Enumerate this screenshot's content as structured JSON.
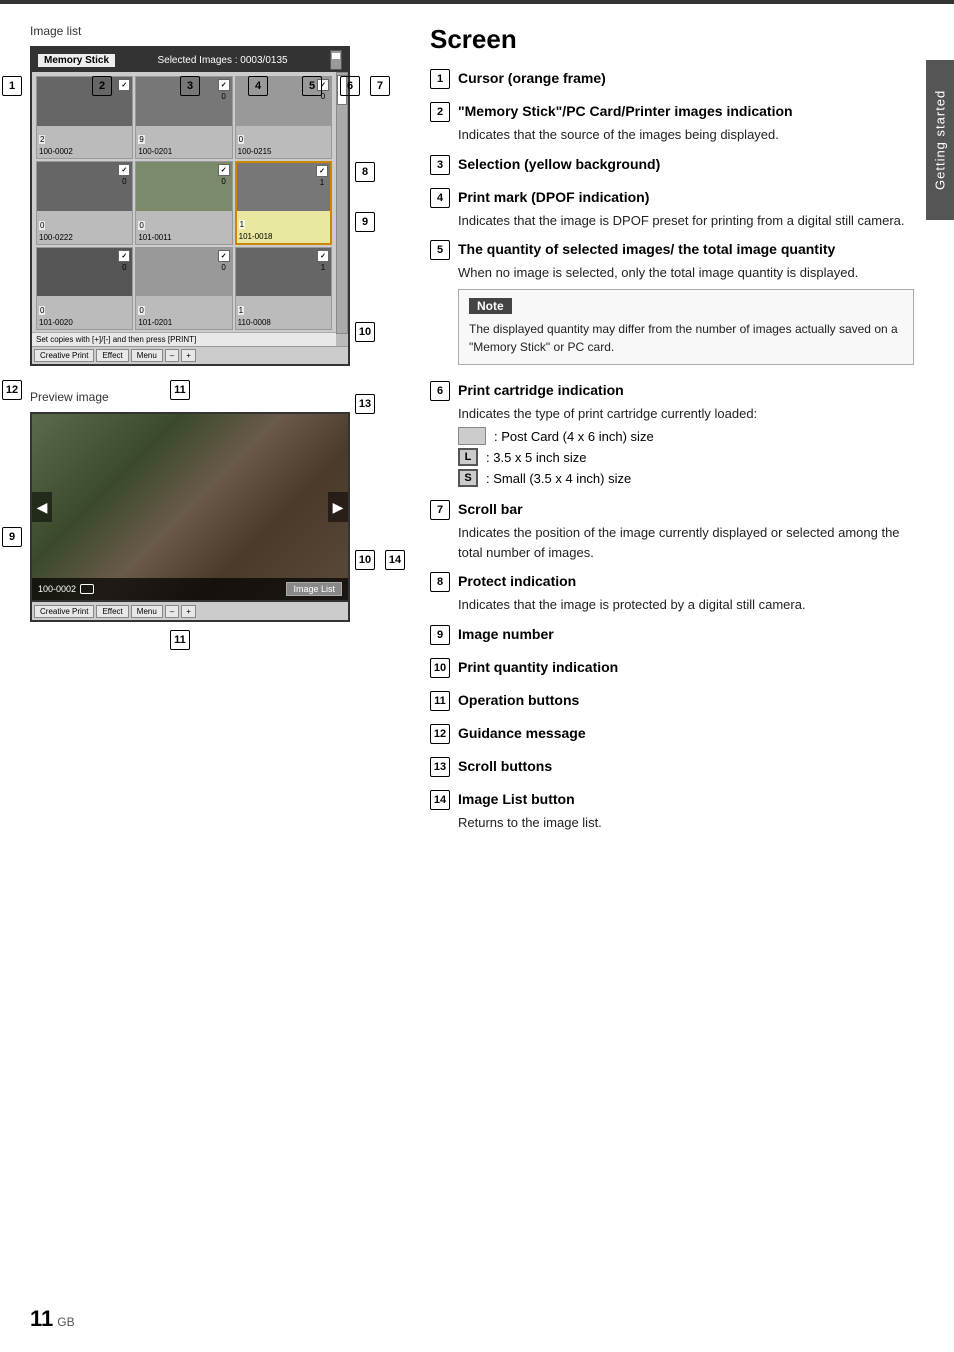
{
  "page": {
    "number": "11",
    "number_suffix": "GB",
    "side_tab": "Getting started"
  },
  "image_list": {
    "label": "Image list",
    "status_bar": {
      "memory_label": "Memory Stick",
      "selected_info": "Selected Images : 0003/0135"
    },
    "thumbnails": [
      {
        "code": "100-0002",
        "num": "2",
        "type": "dark"
      },
      {
        "code": "100-0201",
        "num": "9",
        "type": "med"
      },
      {
        "code": "100-0215",
        "num": "0",
        "type": "light"
      },
      {
        "code": "100-0222",
        "num": "0",
        "type": "dark"
      },
      {
        "code": "101-0011",
        "num": "0",
        "type": "flower"
      },
      {
        "code": "101-0018",
        "num": "1",
        "type": "med"
      },
      {
        "code": "101-0020",
        "num": "0",
        "type": "dark2"
      },
      {
        "code": "101-0201",
        "num": "0",
        "type": "light"
      },
      {
        "code": "110-0008",
        "num": "1",
        "type": "dark"
      }
    ],
    "guidance": "Set copies with [+]/[-] and then press [PRINT]",
    "buttons": [
      "Creative Print",
      "Effect",
      "Menu",
      "–",
      "+"
    ]
  },
  "preview": {
    "label": "Preview image",
    "code": "100-0002",
    "image_list_btn": "Image List",
    "buttons": [
      "Creative Print",
      "Effect",
      "Menu",
      "–",
      "+"
    ]
  },
  "screen": {
    "title": "Screen",
    "items": [
      {
        "num": "1",
        "title": "Cursor (orange frame)",
        "body": ""
      },
      {
        "num": "2",
        "title": "\"Memory Stick\"/PC Card/Printer images indication",
        "body": "Indicates that the source of the images being displayed."
      },
      {
        "num": "3",
        "title": "Selection (yellow background)",
        "body": ""
      },
      {
        "num": "4",
        "title": "Print mark (DPOF indication)",
        "body": "Indicates that the image is DPOF preset for printing from a digital still camera."
      },
      {
        "num": "5",
        "title": "The quantity of selected images/ the total image quantity",
        "body": "When no image is selected, only the total image quantity is displayed.",
        "has_note": true,
        "note": "The displayed quantity may differ from the number of images actually saved on a \"Memory Stick\" or PC card."
      },
      {
        "num": "6",
        "title": "Print cartridge indication",
        "body": "Indicates the type of print cartridge currently loaded:",
        "has_cartridges": true,
        "cartridges": [
          {
            "label": ": Post Card (4 x 6 inch) size"
          },
          {
            "label": ": 3.5 x 5 inch size",
            "letter": "L"
          },
          {
            "label": ": Small (3.5 x 4 inch) size",
            "letter": "S"
          }
        ]
      },
      {
        "num": "7",
        "title": "Scroll bar",
        "body": "Indicates the position of the image currently displayed or selected among the total number of images."
      },
      {
        "num": "8",
        "title": "Protect indication",
        "body": "Indicates that the image is protected by a digital still camera."
      },
      {
        "num": "9",
        "title": "Image number",
        "body": ""
      },
      {
        "num": "10",
        "title": "Print quantity indication",
        "body": ""
      },
      {
        "num": "11",
        "title": "Operation buttons",
        "body": ""
      },
      {
        "num": "12",
        "title": "Guidance message",
        "body": ""
      },
      {
        "num": "13",
        "title": "Scroll buttons",
        "body": ""
      },
      {
        "num": "14",
        "title": "Image List button",
        "body": "Returns to the image list."
      }
    ],
    "note_label": "Note"
  },
  "callout_numbers_image_list": {
    "n1": "1",
    "n2": "2",
    "n3": "3",
    "n4": "4",
    "n5": "5",
    "n6": "6",
    "n7": "7",
    "n8": "8",
    "n9": "9",
    "n10": "10",
    "n11": "11",
    "n12": "12"
  },
  "callout_numbers_preview": {
    "n9": "9",
    "n10": "10",
    "n11": "11",
    "n13": "13",
    "n14": "14"
  }
}
